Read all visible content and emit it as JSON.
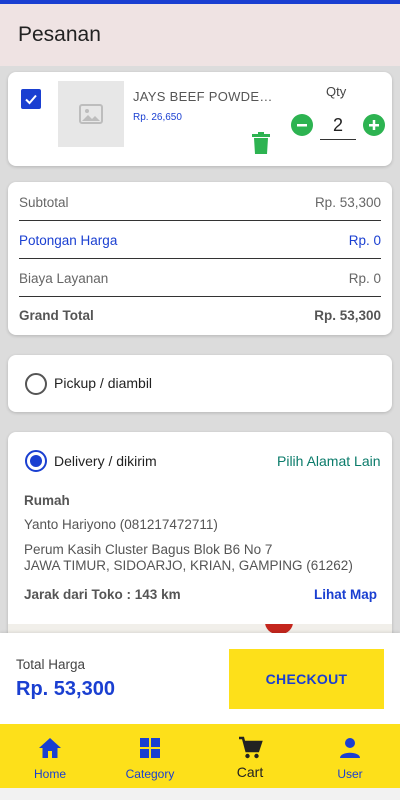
{
  "app": {
    "title": "Pesanan"
  },
  "cart": {
    "item": {
      "name": "JAYS BEEF POWDER...",
      "price": "Rp. 26,650",
      "qty_label": "Qty",
      "qty": "2",
      "checked": true
    }
  },
  "summary": {
    "rows": [
      {
        "label": "Subtotal",
        "value": "Rp. 53,300"
      },
      {
        "label": "Potongan Harga",
        "value": "Rp. 0"
      },
      {
        "label": "Biaya Layanan",
        "value": "Rp. 0"
      },
      {
        "label": "Grand Total",
        "value": "Rp. 53,300"
      }
    ]
  },
  "shipping": {
    "pickup_label": "Pickup / diambil",
    "delivery_label": "Delivery / dikirim",
    "selected": "delivery",
    "alt_address_label": "Pilih Alamat Lain",
    "address": {
      "title": "Rumah",
      "recipient": "Yanto Hariyono (081217472711)",
      "line1": "Perum Kasih Cluster Bagus Blok B6 No 7",
      "line2": "JAWA TIMUR, SIDOARJO, KRIAN, GAMPING (61262)"
    },
    "distance": "Jarak dari Toko : 143 km",
    "map_link": "Lihat Map"
  },
  "footer": {
    "total_label": "Total Harga",
    "total_value": "Rp. 53,300",
    "checkout_label": "CHECKOUT"
  },
  "nav": {
    "items": [
      {
        "label": "Home",
        "icon": "home-icon"
      },
      {
        "label": "Category",
        "icon": "category-icon"
      },
      {
        "label": "Cart",
        "icon": "cart-icon"
      },
      {
        "label": "User",
        "icon": "user-icon"
      }
    ],
    "active": "Cart"
  },
  "colors": {
    "primary": "#1a3fd1",
    "accent_yellow": "#fde01a",
    "qty_green": "#2db351",
    "link_teal": "#0a7b6a",
    "appbar_bg": "#efe3e3"
  }
}
